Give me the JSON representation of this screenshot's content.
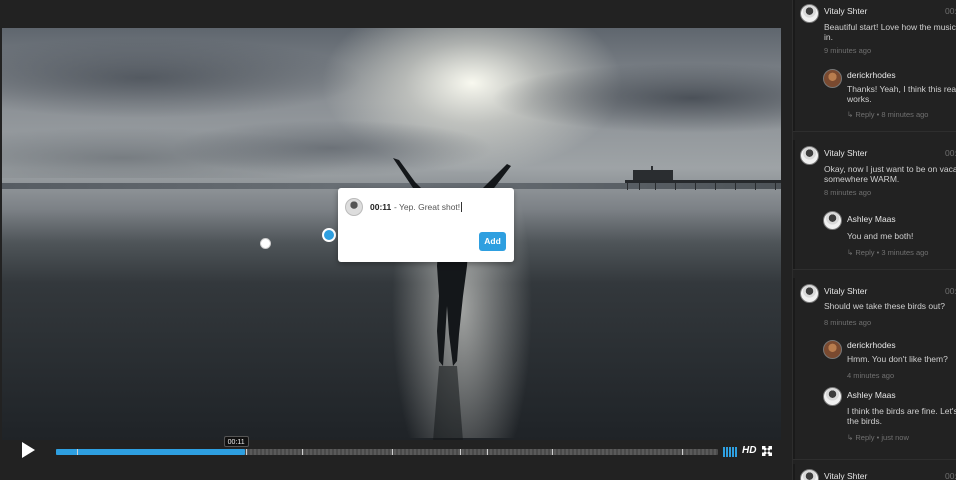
{
  "video": {
    "tooltip_time": "00:11",
    "progress_fraction": 0.285,
    "hd_label": "HD",
    "accent_color": "#2e9fe0"
  },
  "popover": {
    "time": "00:11",
    "text": " - Yep. Great shot!",
    "add_label": "Add"
  },
  "comments": [
    {
      "author": "Vitaly Shter",
      "time": "00:",
      "body_lines": [
        "Beautiful start! Love how the music s",
        "in."
      ],
      "age": "9 minutes ago",
      "replies": [
        {
          "author": "derickrhodes",
          "body_lines": [
            "Thanks! Yeah, I think this really",
            "works."
          ],
          "reply_label": "Reply",
          "age": "8 minutes ago"
        }
      ]
    },
    {
      "author": "Vitaly Shter",
      "time": "00:",
      "body_lines": [
        "Okay, now I just want to be on vacati",
        "somewhere WARM."
      ],
      "age": "8 minutes ago",
      "replies": [
        {
          "author": "Ashley Maas",
          "body_lines": [
            "You and me both!"
          ],
          "reply_label": "Reply",
          "age": "3 minutes ago"
        }
      ]
    },
    {
      "author": "Vitaly Shter",
      "time": "00:",
      "body_lines": [
        "Should we take these birds out?"
      ],
      "age": "8 minutes ago",
      "replies": [
        {
          "author": "derickrhodes",
          "body_lines": [
            "Hmm. You don't like them?"
          ],
          "age": "4 minutes ago"
        },
        {
          "author": "Ashley Maas",
          "body_lines": [
            "I think the birds are fine. Let's",
            "the birds."
          ],
          "reply_label": "Reply",
          "age": "just now"
        }
      ]
    },
    {
      "author": "Vitaly Shter",
      "time": "00:"
    }
  ]
}
